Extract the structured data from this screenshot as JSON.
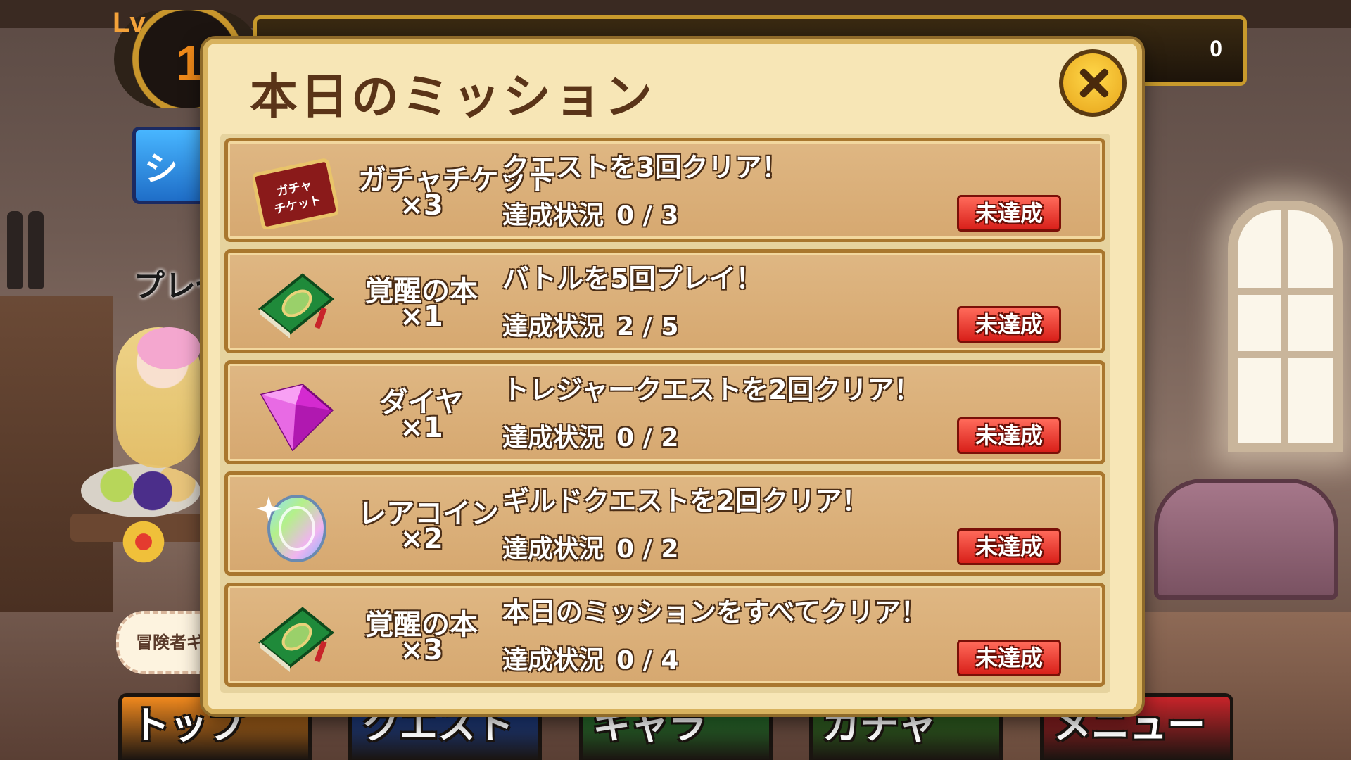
{
  "hud": {
    "level_label": "Lv",
    "level_value": "1",
    "counter_value": "0"
  },
  "side": {
    "shop_label": "ショ",
    "present_label": "プレゼ",
    "adventurer_label": "冒険者ギ"
  },
  "modal": {
    "title": "本日のミッション",
    "missions": [
      {
        "reward_icon": "gacha-ticket-icon",
        "reward_icon_text": "ガチャチケット",
        "reward_name": "ガチャチケット",
        "reward_qty": "×3",
        "description": "クエストを3回クリア！",
        "progress_label": "達成状況",
        "progress_current": "0",
        "progress_separator": "/",
        "progress_total": "3",
        "status": "未達成"
      },
      {
        "reward_icon": "awakening-book-icon",
        "reward_name": "覚醒の本",
        "reward_qty": "×1",
        "description": "バトルを5回プレイ！",
        "progress_label": "達成状況",
        "progress_current": "2",
        "progress_separator": "/",
        "progress_total": "5",
        "status": "未達成"
      },
      {
        "reward_icon": "diamond-icon",
        "reward_name": "ダイヤ",
        "reward_qty": "×1",
        "description": "トレジャークエストを2回クリア！",
        "progress_label": "達成状況",
        "progress_current": "0",
        "progress_separator": "/",
        "progress_total": "2",
        "status": "未達成"
      },
      {
        "reward_icon": "rare-coin-icon",
        "reward_name": "レアコイン",
        "reward_qty": "×2",
        "description": "ギルドクエストを2回クリア！",
        "progress_label": "達成状況",
        "progress_current": "0",
        "progress_separator": "/",
        "progress_total": "2",
        "status": "未達成"
      },
      {
        "reward_icon": "awakening-book-icon",
        "reward_name": "覚醒の本",
        "reward_qty": "×3",
        "description": "本日のミッションをすべてクリア！",
        "progress_label": "達成状況",
        "progress_current": "0",
        "progress_separator": "/",
        "progress_total": "4",
        "status": "未達成"
      }
    ]
  },
  "nav": [
    {
      "label": "トップ",
      "color": "#f28a1e"
    },
    {
      "label": "クエスト",
      "color": "#1f4fb8"
    },
    {
      "label": "キャラ",
      "color": "#2f9a3a"
    },
    {
      "label": "ガチャ",
      "color": "#3a8a2a"
    },
    {
      "label": "メニュー",
      "color": "#c8242a"
    }
  ],
  "colors": {
    "status_incomplete": "#d8201a",
    "modal_bg": "#f7e6b6",
    "row_bg": "#d6a870",
    "title_text": "#5a3418"
  }
}
